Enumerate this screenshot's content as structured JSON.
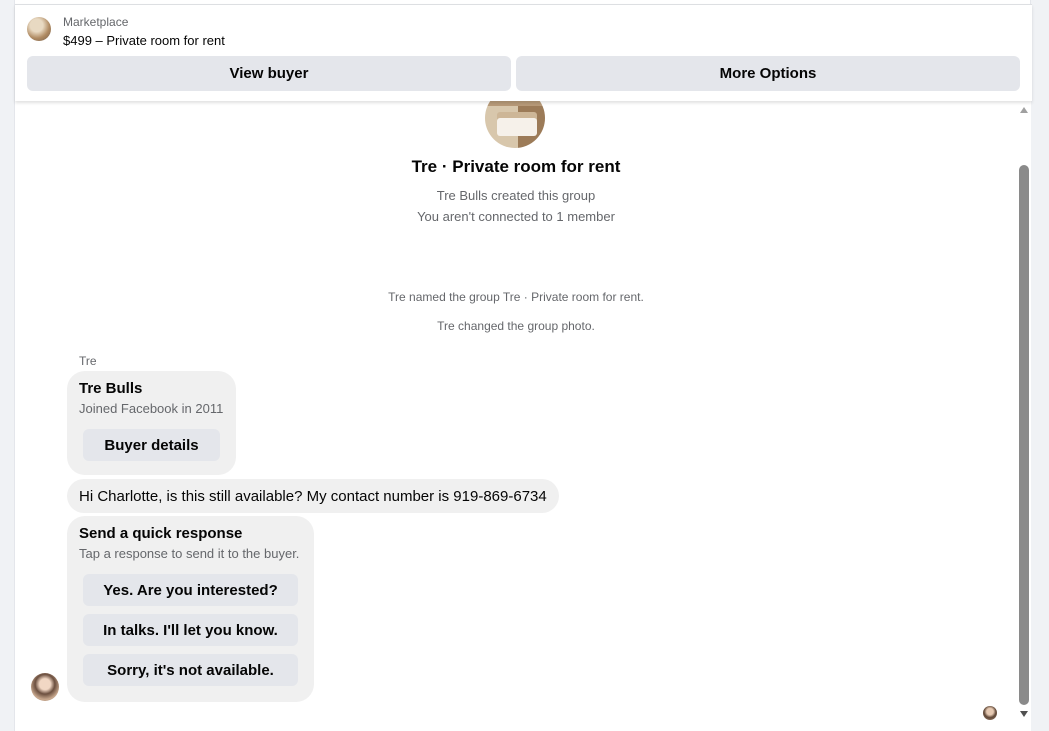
{
  "header": {
    "marketplace_label": "Marketplace",
    "listing_title": "$499 – Private room for rent",
    "view_buyer_label": "View buyer",
    "more_options_label": "More Options"
  },
  "group": {
    "name": "Tre · Private room for rent",
    "created_by": "Tre Bulls created this group",
    "connection_note": "You aren't connected to 1 member"
  },
  "system_messages": [
    "Tre named the group Tre · Private room for rent.",
    "Tre changed the group photo."
  ],
  "thread": {
    "sender_label": "Tre",
    "profile_card": {
      "name": "Tre Bulls",
      "joined": "Joined Facebook in 2011",
      "button_label": "Buyer details"
    },
    "message": "Hi Charlotte, is this still available? My contact number is 919-869-6734",
    "quick_response": {
      "title": "Send a quick response",
      "subtitle": "Tap a response to send it to the buyer.",
      "options": [
        "Yes. Are you interested?",
        "In talks. I'll let you know.",
        "Sorry, it's not available."
      ]
    }
  },
  "icons": {
    "listing_thumbnail": "room-photo-thumbnail",
    "group_photo": "room-photo",
    "sender_avatar": "user-avatar",
    "read_receipt": "seen-avatar",
    "scroll_up": "chevron-up-icon",
    "scroll_down": "chevron-down-icon"
  },
  "colors": {
    "page_background": "#f0f2f5",
    "button_background": "#e4e6eb",
    "bubble_background": "#f0f0f0",
    "secondary_text": "#65676b"
  }
}
